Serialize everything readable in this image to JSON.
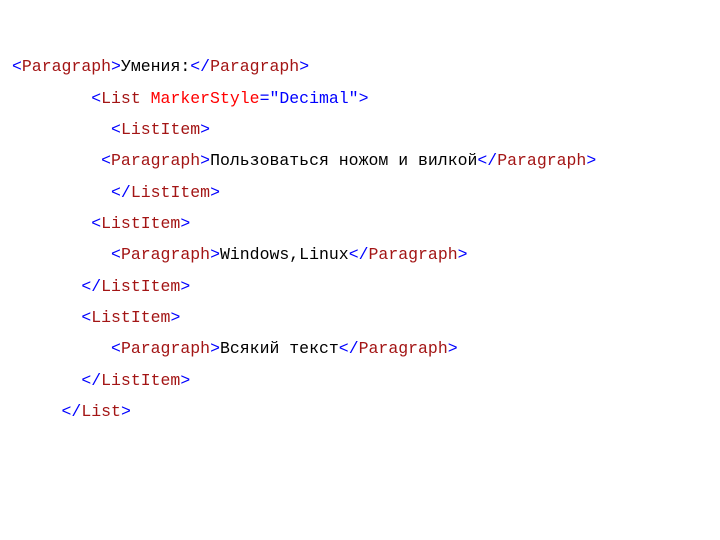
{
  "tags": {
    "paragraph": "Paragraph",
    "list": "List",
    "listitem": "ListItem"
  },
  "attrs": {
    "markerstyle_name": "MarkerStyle",
    "markerstyle_value": "\"Decimal\""
  },
  "text": {
    "skills_label": "Умения:",
    "item1": "Пользоваться ножом и вилкой",
    "item2": "Windows,Linux",
    "item3": "Всякий текст"
  }
}
